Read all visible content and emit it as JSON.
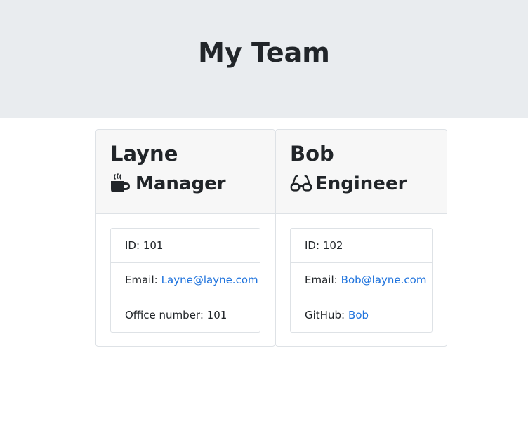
{
  "header": {
    "title": "My Team"
  },
  "team": [
    {
      "name": "Layne",
      "role": "Manager",
      "role_icon": "mug-icon",
      "id_label": "ID:",
      "id_value": "101",
      "email_label": "Email:",
      "email": "Layne@layne.com",
      "extra_label": "Office number:",
      "extra_value": "101"
    },
    {
      "name": "Bob",
      "role": "Engineer",
      "role_icon": "glasses-icon",
      "id_label": "ID:",
      "id_value": "102",
      "email_label": "Email:",
      "email": "Bob@layne.com",
      "extra_label": "GitHub:",
      "extra_value": "Bob"
    }
  ],
  "colors": {
    "header_bg": "#e9ecef",
    "link": "#1f73dd",
    "card_header_bg": "#f7f7f7"
  }
}
